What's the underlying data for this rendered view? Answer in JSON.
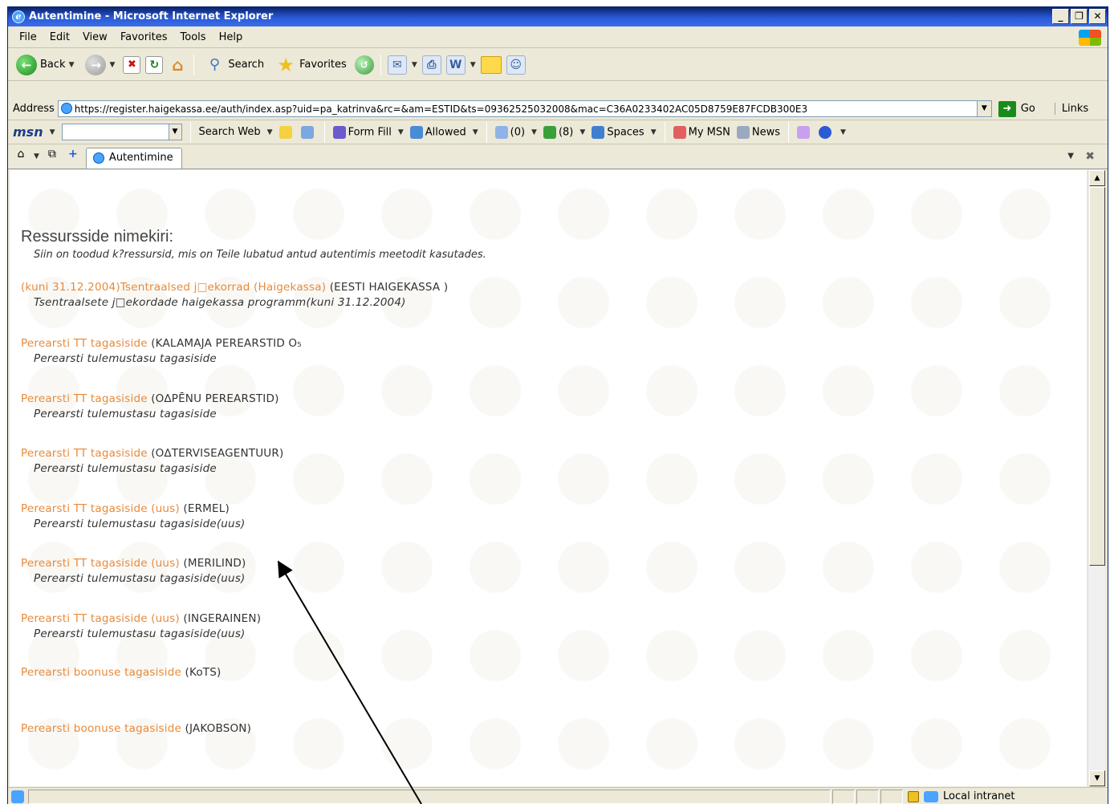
{
  "window": {
    "title": "Autentimine - Microsoft Internet Explorer"
  },
  "menu": [
    {
      "label": "File"
    },
    {
      "label": "Edit"
    },
    {
      "label": "View"
    },
    {
      "label": "Favorites"
    },
    {
      "label": "Tools"
    },
    {
      "label": "Help"
    }
  ],
  "toolbar": {
    "back": "Back",
    "search": "Search",
    "favorites": "Favorites"
  },
  "address": {
    "label": "Address",
    "url": "https://register.haigekassa.ee/auth/index.asp?uid=pa_katrinva&rc=&am=ESTID&ts=09362525032008&mac=C36A0233402AC05D8759E87FCDB300E3",
    "go": "Go",
    "links": "Links"
  },
  "msn": {
    "logo": "msn",
    "search_web": "Search Web",
    "form_fill": "Form Fill",
    "allowed": "Allowed",
    "mail_count": "(0)",
    "messenger_count": "(8)",
    "spaces": "Spaces",
    "my_msn": "My MSN",
    "news": "News"
  },
  "tab": {
    "title": "Autentimine"
  },
  "content": {
    "heading": "Ressursside nimekiri:",
    "subheading": "Siin on toodud k?ressursid, mis on Teile lubatud antud autentimis meetodit kasutades.",
    "resources": [
      {
        "link": "(kuni 31.12.2004)Tsentraalsed j□ekorrad (Haigekassa)",
        "org": " (EESTI HAIGEKASSA )",
        "desc": "Tsentraalsete j□ekordade haigekassa programm(kuni 31.12.2004)"
      },
      {
        "link": "Perearsti TT tagasiside",
        "org": " (KALAMAJA PEREARSTID O₅",
        "desc": "Perearsti tulemustasu tagasiside"
      },
      {
        "link": "Perearsti TT tagasiside",
        "org": " (O∆PĒNU PEREARSTID)",
        "desc": "Perearsti tulemustasu tagasiside"
      },
      {
        "link": "Perearsti TT tagasiside",
        "org": " (O∆TERVISEAGENTUUR)",
        "desc": "Perearsti tulemustasu tagasiside"
      },
      {
        "link": "Perearsti TT tagasiside (uus)",
        "org": " (ERMEL)",
        "desc": "Perearsti tulemustasu tagasiside(uus)"
      },
      {
        "link": "Perearsti TT tagasiside (uus)",
        "org": " (MERILIND)",
        "desc": "Perearsti tulemustasu tagasiside(uus)"
      },
      {
        "link": "Perearsti TT tagasiside (uus)",
        "org": " (INGERAINEN)",
        "desc": "Perearsti tulemustasu tagasiside(uus)"
      },
      {
        "link": "Perearsti boonuse tagasiside",
        "org": " (KoTS)",
        "desc": ""
      },
      {
        "link": "Perearsti boonuse tagasiside",
        "org": " (JAKOBSON)",
        "desc": ""
      }
    ]
  },
  "status": {
    "zone": "Local intranet"
  },
  "colors": {
    "link": "#e88a3a",
    "title_bar": "#0a246a"
  },
  "icons": [
    "ie-icon",
    "back-icon",
    "forward-icon",
    "stop-icon",
    "refresh-icon",
    "home-icon",
    "search-icon",
    "favorites-star-icon",
    "lock-icon",
    "zone-icon"
  ]
}
